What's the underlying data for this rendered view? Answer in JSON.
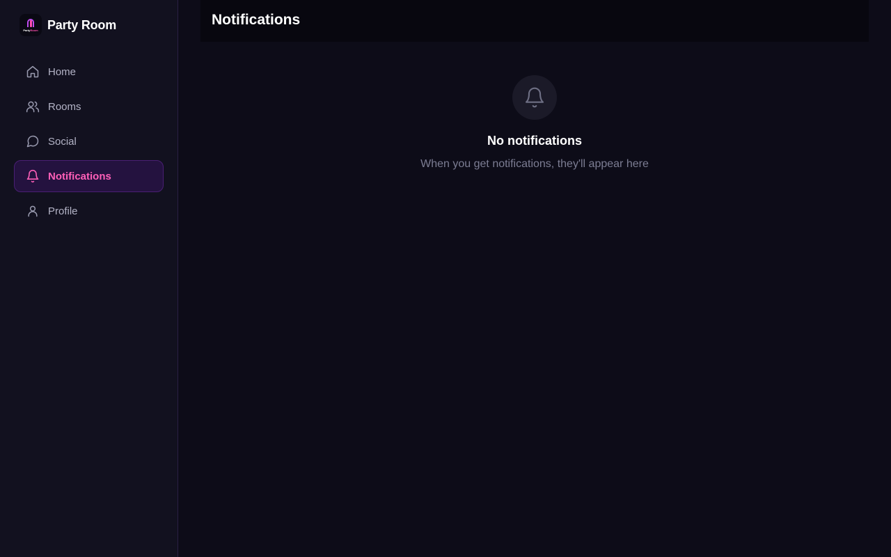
{
  "app": {
    "name": "Party Room",
    "logo_text_a": "Party",
    "logo_text_b": "Room"
  },
  "sidebar": {
    "items": [
      {
        "label": "Home",
        "icon": "home-icon",
        "active": false
      },
      {
        "label": "Rooms",
        "icon": "users-icon",
        "active": false
      },
      {
        "label": "Social",
        "icon": "chat-icon",
        "active": false
      },
      {
        "label": "Notifications",
        "icon": "bell-icon",
        "active": true
      },
      {
        "label": "Profile",
        "icon": "user-icon",
        "active": false
      }
    ]
  },
  "header": {
    "title": "Notifications"
  },
  "empty_state": {
    "icon": "bell-icon",
    "title": "No notifications",
    "description": "When you get notifications, they'll appear here"
  },
  "colors": {
    "background": "#0d0c18",
    "sidebar": "#12111f",
    "accent": "#ff5fb8",
    "active_bg": "#24123f",
    "muted_text": "#7c7d93"
  }
}
